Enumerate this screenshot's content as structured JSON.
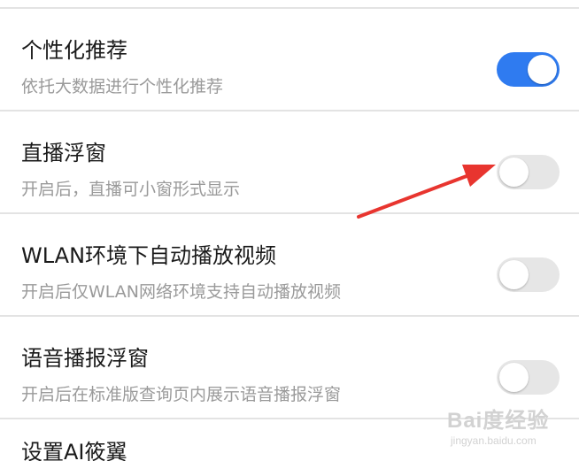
{
  "settings": {
    "items": [
      {
        "title": "个性化推荐",
        "subtitle": "依托大数据进行个性化推荐",
        "toggle_on": true
      },
      {
        "title": "直播浮窗",
        "subtitle": "开启后，直播可小窗形式显示",
        "toggle_on": false
      },
      {
        "title": "WLAN环境下自动播放视频",
        "subtitle": "开启后仅WLAN网络环境支持自动播放视频",
        "toggle_on": false
      },
      {
        "title": "语音播报浮窗",
        "subtitle": "开启后在标准版查询页内展示语音播报浮窗",
        "toggle_on": false
      }
    ],
    "partial_item_title": "设置AI筱翼"
  },
  "colors": {
    "toggle_on": "#2f7bf0",
    "toggle_off": "#e6e6e6",
    "annotation_arrow": "#e8352f",
    "divider": "#e3e3e3"
  },
  "watermark": {
    "main": "Bai度经验",
    "sub": "jingyan.baidu.com"
  }
}
